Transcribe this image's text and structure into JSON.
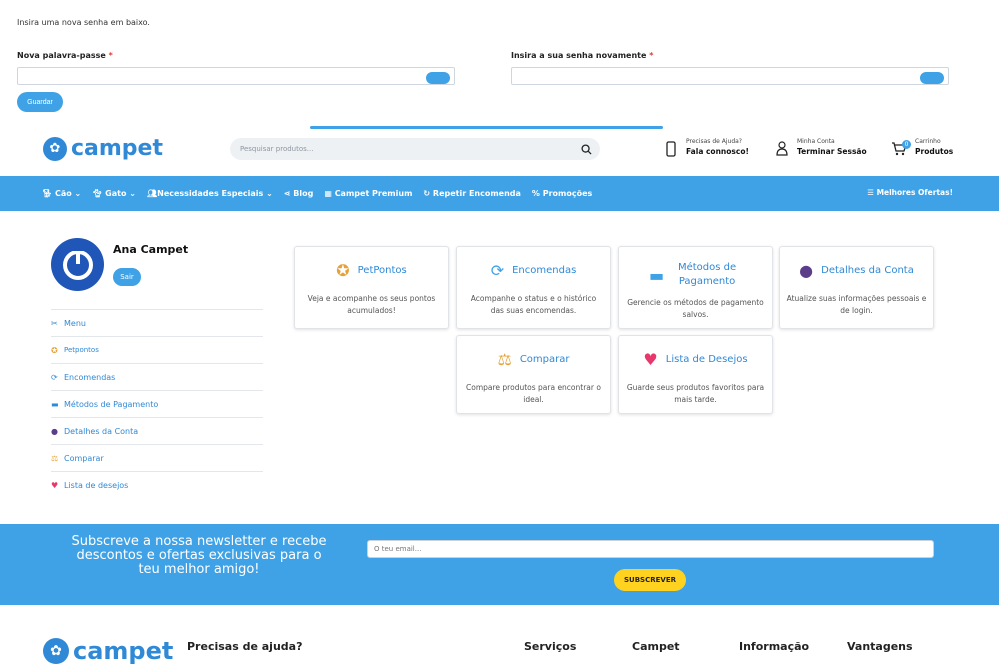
{
  "password_form": {
    "intro": "Insira uma nova senha em baixo.",
    "new_password_label": "Nova palavra-passe",
    "repeat_password_label": "Insira a sua senha novamente",
    "required_mark": "*",
    "save_label": "Guardar"
  },
  "header": {
    "logo_text": "campet",
    "search_placeholder": "Pesquisar produtos...",
    "help_small": "Precisas de Ajuda?",
    "help_big": "Fala connosco!",
    "account_small": "Minha Conta",
    "account_big": "Terminar Sessão",
    "cart_small": "Carrinho",
    "cart_big": "Produtos",
    "cart_count": "0"
  },
  "nav": {
    "items": [
      {
        "label": "Cão",
        "icon": "dog-icon"
      },
      {
        "label": "Gato",
        "icon": "cat-icon"
      },
      {
        "label": "Necessidades Especiais",
        "icon": "user-group-icon"
      },
      {
        "label": "Blog",
        "icon": "share-icon"
      },
      {
        "label": "Campet Premium",
        "icon": "calendar-icon"
      },
      {
        "label": "Repetir Encomenda",
        "icon": "repeat-icon"
      },
      {
        "label": "Promoções",
        "icon": "percent-icon"
      }
    ],
    "deals": "Melhores Ofertas!"
  },
  "account": {
    "name": "Ana Campet",
    "logout": "Sair",
    "menu": [
      {
        "label": "Menu",
        "icon": "tools-icon"
      },
      {
        "label": "Petpontos",
        "icon": "medal-icon"
      },
      {
        "label": "Encomendas",
        "icon": "refresh-icon"
      },
      {
        "label": "Métodos de Pagamento",
        "icon": "credit-card-icon"
      },
      {
        "label": "Detalhes da Conta",
        "icon": "person-icon"
      },
      {
        "label": "Comparar",
        "icon": "scales-icon"
      },
      {
        "label": "Lista de desejos",
        "icon": "heart-icon"
      }
    ]
  },
  "cards": [
    {
      "title": "PetPontos",
      "desc": "Veja e acompanhe os seus pontos acumulados!",
      "icon": "medal-icon"
    },
    {
      "title": "Encomendas",
      "desc": "Acompanhe o status e o histórico das suas encomendas.",
      "icon": "refresh-icon"
    },
    {
      "title": "Métodos de Pagamento",
      "desc": "Gerencie os métodos de pagamento salvos.",
      "icon": "credit-card-icon"
    },
    {
      "title": "Detalhes da Conta",
      "desc": "Atualize suas informações pessoais e de login.",
      "icon": "person-icon"
    },
    {
      "title": "Comparar",
      "desc": "Compare produtos para encontrar o ideal.",
      "icon": "scales-icon"
    },
    {
      "title": "Lista de Desejos",
      "desc": "Guarde seus produtos favoritos para mais tarde.",
      "icon": "heart-icon"
    }
  ],
  "newsletter": {
    "text": "Subscreve a nossa newsletter e recebe descontos e ofertas exclusivas para o teu melhor amigo!",
    "placeholder": "O teu email...",
    "button": "SUBSCREVER"
  },
  "footer": {
    "help": "Precisas de ajuda?",
    "columns": [
      "Serviços",
      "Campet",
      "Informação",
      "Vantagens"
    ]
  },
  "colors": {
    "accent": "#3fa2e6",
    "brand": "#2f89d6",
    "yellow": "#ffd21f"
  }
}
